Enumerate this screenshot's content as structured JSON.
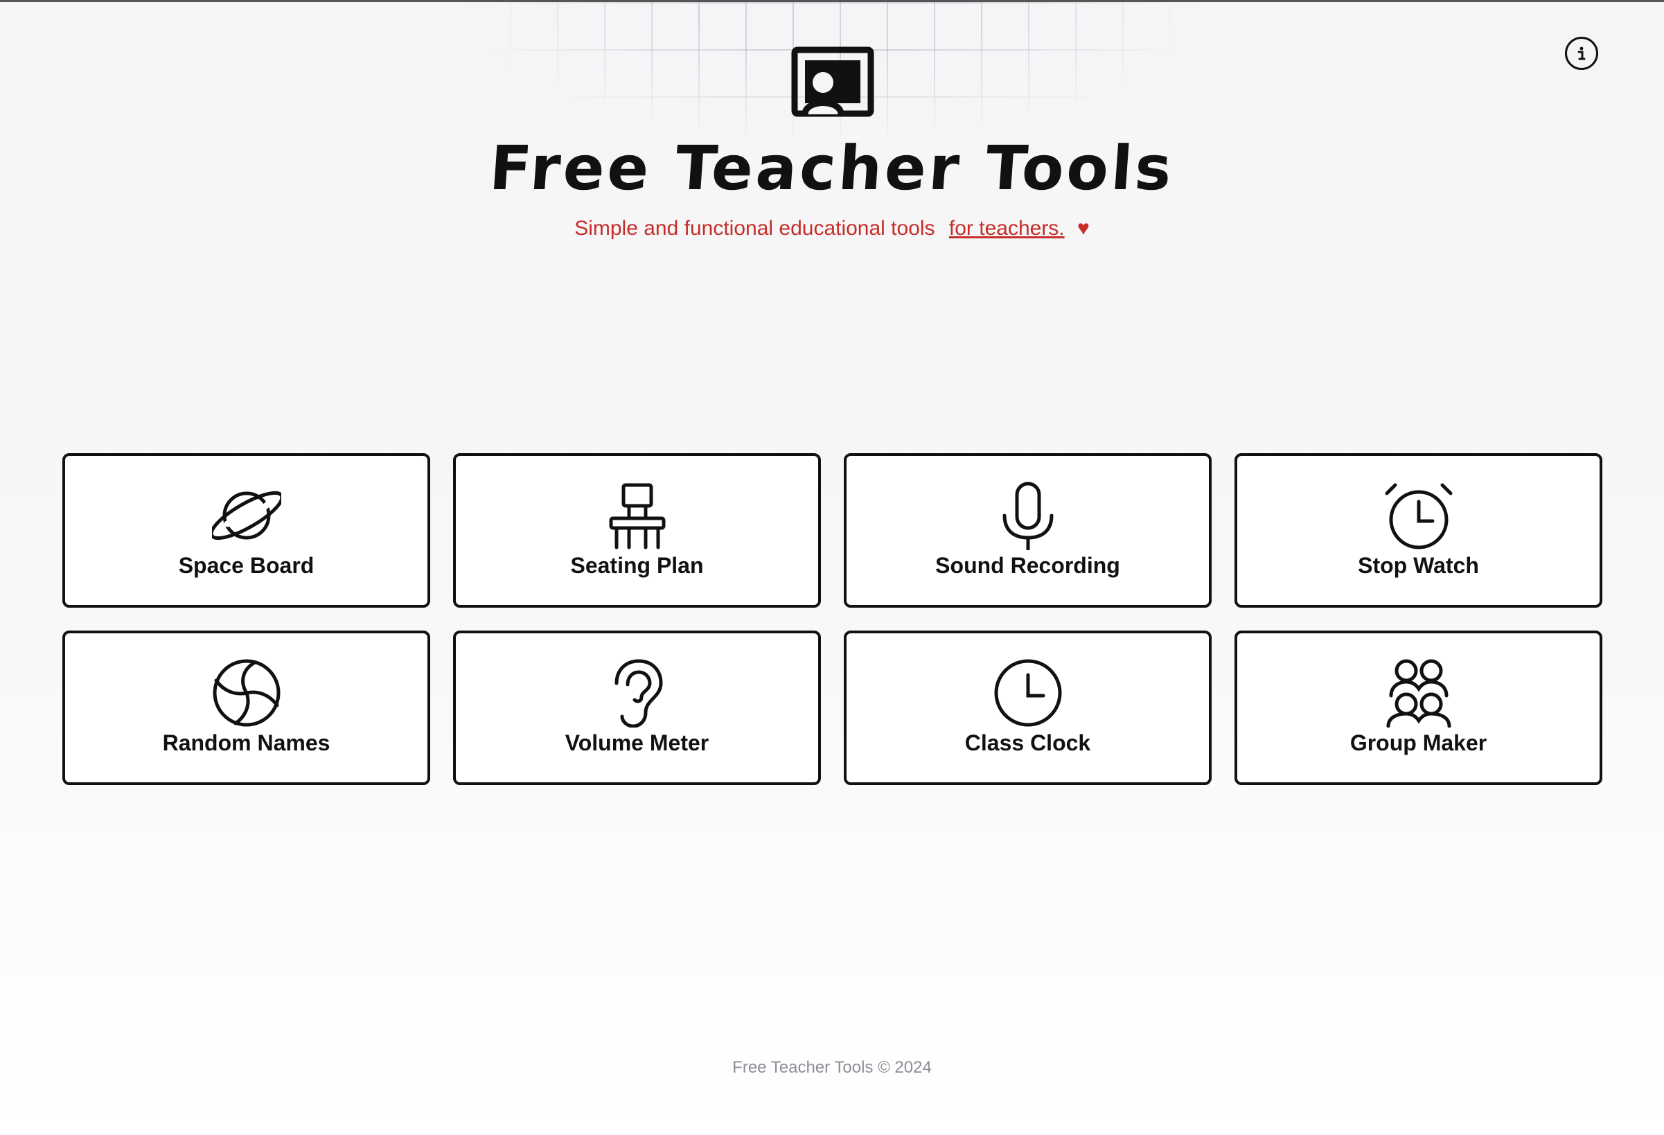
{
  "header": {
    "title": "Free Teacher Tools",
    "subtitle": "Simple and functional educational tools",
    "subtitle_link": "for teachers.",
    "heart": "♥",
    "logo_icon": "teacher-board-icon",
    "info_icon": "info-icon"
  },
  "tools": [
    {
      "label": "Space Board",
      "icon": "planet-icon"
    },
    {
      "label": "Seating Plan",
      "icon": "chair-icon"
    },
    {
      "label": "Sound Recording",
      "icon": "microphone-icon"
    },
    {
      "label": "Stop Watch",
      "icon": "alarm-clock-icon"
    },
    {
      "label": "Random Names",
      "icon": "wheel-icon"
    },
    {
      "label": "Volume Meter",
      "icon": "ear-icon"
    },
    {
      "label": "Class Clock",
      "icon": "clock-icon"
    },
    {
      "label": "Group Maker",
      "icon": "group-icon"
    }
  ],
  "footer": {
    "copyright": "Free Teacher Tools © 2024"
  },
  "colors": {
    "accent": "#c62d27",
    "text": "#111111",
    "footer_text": "#8c8f98"
  }
}
